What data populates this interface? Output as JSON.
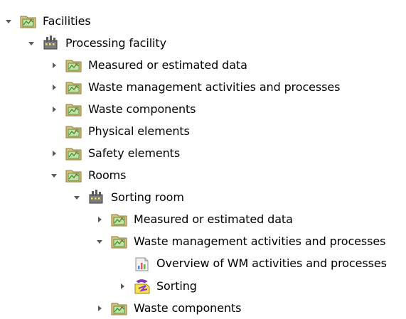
{
  "tree": {
    "rows": [
      {
        "label": "Facilities",
        "icon": "folder-map-icon",
        "expanded": true
      },
      {
        "label": "Processing facility",
        "icon": "factory-icon",
        "expanded": true
      },
      {
        "label": "Measured or estimated data",
        "icon": "folder-map-icon",
        "expanded": false
      },
      {
        "label": "Waste management activities and processes",
        "icon": "folder-map-icon",
        "expanded": false
      },
      {
        "label": "Waste components",
        "icon": "folder-map-icon",
        "expanded": false
      },
      {
        "label": "Physical elements",
        "icon": "folder-map-icon",
        "expanded": null
      },
      {
        "label": "Safety elements",
        "icon": "folder-map-icon",
        "expanded": false
      },
      {
        "label": "Rooms",
        "icon": "folder-map-icon",
        "expanded": true
      },
      {
        "label": "Sorting room",
        "icon": "factory-icon",
        "expanded": true
      },
      {
        "label": "Measured or estimated data",
        "icon": "folder-map-icon",
        "expanded": false
      },
      {
        "label": "Waste management activities and processes",
        "icon": "folder-map-icon",
        "expanded": true
      },
      {
        "label": "Overview of WM activities and processes",
        "icon": "chart-icon",
        "expanded": null
      },
      {
        "label": "Sorting",
        "icon": "process-icon",
        "expanded": false
      },
      {
        "label": "Waste components",
        "icon": "folder-map-icon",
        "expanded": false
      }
    ]
  }
}
